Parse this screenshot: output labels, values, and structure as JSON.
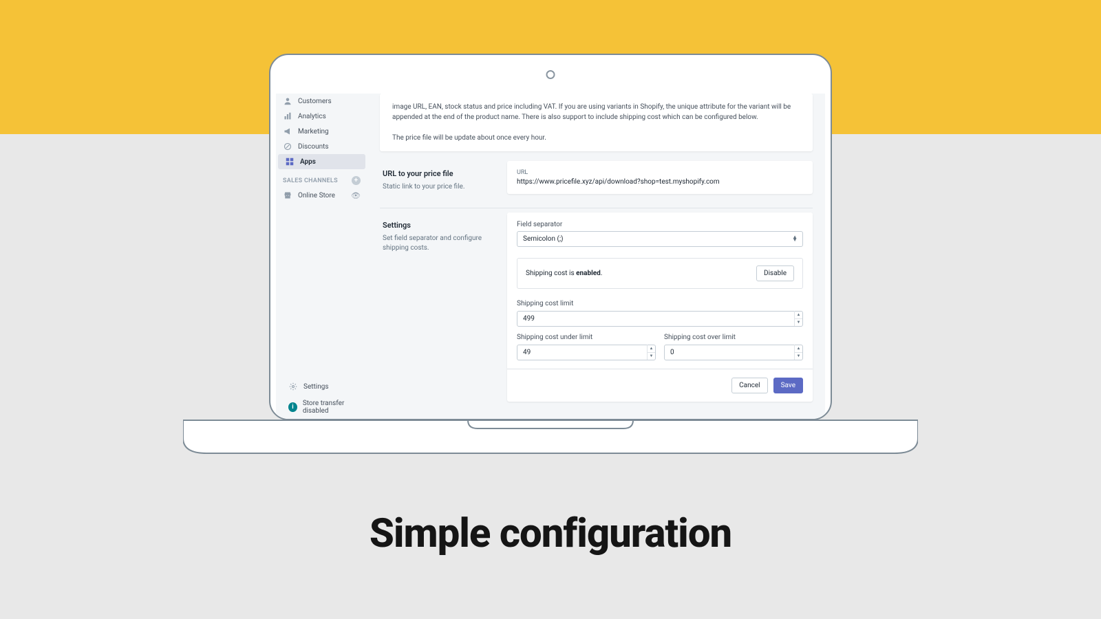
{
  "caption": "Simple configuration",
  "sidebar": {
    "items": [
      {
        "label": "Customers",
        "icon": "person"
      },
      {
        "label": "Analytics",
        "icon": "bars"
      },
      {
        "label": "Marketing",
        "icon": "megaphone"
      },
      {
        "label": "Discounts",
        "icon": "discount"
      },
      {
        "label": "Apps",
        "icon": "apps",
        "active": true
      }
    ],
    "channels_label": "SALES CHANNELS",
    "channels": [
      {
        "label": "Online Store"
      }
    ],
    "settings_label": "Settings",
    "transfer_label": "Store transfer disabled"
  },
  "intro": {
    "line1": "image URL, EAN, stock status and price including VAT. If you are using variants in Shopify, the unique attribute for the variant will be appended at the end of the product name. There is also support to include shipping cost which can be configured below.",
    "line2": "The price file will be update about once every hour."
  },
  "url_section": {
    "title": "URL to your price file",
    "desc": "Static link to your price file.",
    "label": "URL",
    "value": "https://www.pricefile.xyz/api/download?shop=test.myshopify.com"
  },
  "settings": {
    "title": "Settings",
    "desc": "Set field separator and configure shipping costs.",
    "separator_label": "Field separator",
    "separator_value": "Semicolon (;)",
    "shipping_status_prefix": "Shipping cost is ",
    "shipping_status_value": "enabled",
    "disable_label": "Disable",
    "limit_label": "Shipping cost limit",
    "limit_value": "499",
    "under_label": "Shipping cost under limit",
    "under_value": "49",
    "over_label": "Shipping cost over limit",
    "over_value": "0",
    "cancel_label": "Cancel",
    "save_label": "Save"
  }
}
